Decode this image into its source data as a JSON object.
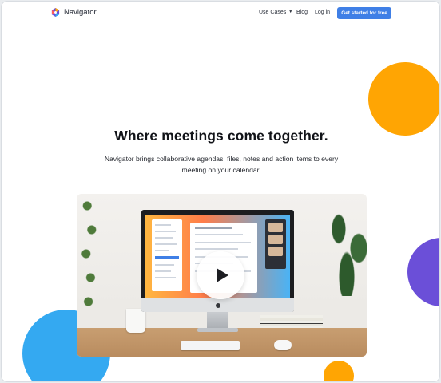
{
  "header": {
    "brand": "Navigator",
    "nav": [
      {
        "label": "Use Cases"
      },
      {
        "label": "Blog"
      },
      {
        "label": "Log in"
      }
    ],
    "cta_label": "Get started for free"
  },
  "hero": {
    "headline": "Where meetings come together.",
    "subtitle": "Navigator brings collaborative agendas, files, notes and action items to every meeting on your calendar."
  },
  "video": {
    "play_icon": "play-icon"
  },
  "colors": {
    "cta": "#3f7fe6",
    "orange": "#ffa503",
    "purple": "#6b4fd8",
    "blue": "#34a9f1"
  }
}
